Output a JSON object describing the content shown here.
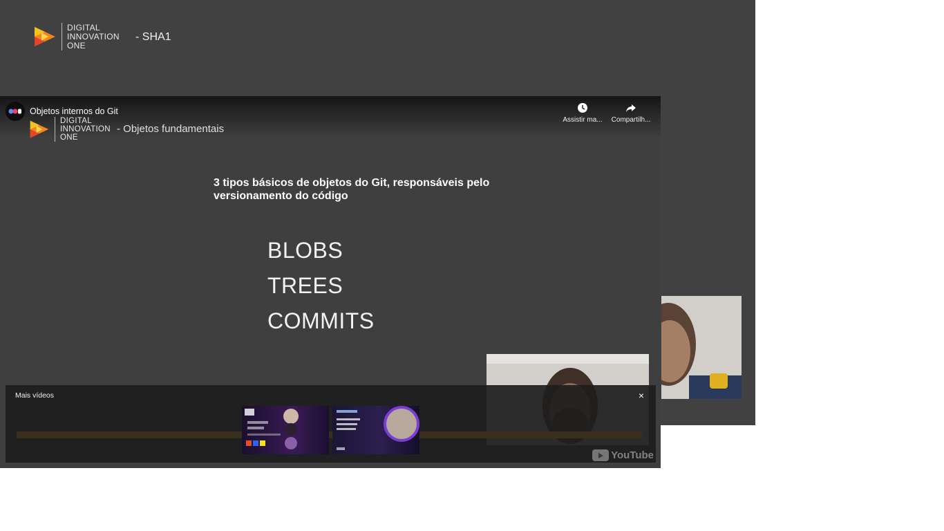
{
  "slide": {
    "logo_line1": "DIGITAL",
    "logo_line2": "INNOVATION",
    "logo_line3": "ONE",
    "suffix": "- SHA1"
  },
  "player": {
    "title": "Objetos internos do Git",
    "watch_later_label": "Assistir ma...",
    "share_label": "Compartilh...",
    "video_logo_line1": "DIGITAL",
    "video_logo_line2": "INNOVATION",
    "video_logo_line3": "ONE",
    "video_suffix": "- Objetos fundamentais",
    "heading": "3 tipos básicos de objetos do Git, responsáveis pelo versionamento do código",
    "objects": [
      "BLOBS",
      "TREES",
      "COMMITS"
    ],
    "more_videos_label": "Mais vídeos",
    "close_icon": "×",
    "brand": "YouTube"
  },
  "colors": {
    "background": "#414141",
    "logo_orange": "#f0871e",
    "logo_yellow": "#f4c21e",
    "logo_red": "#e5442a"
  }
}
